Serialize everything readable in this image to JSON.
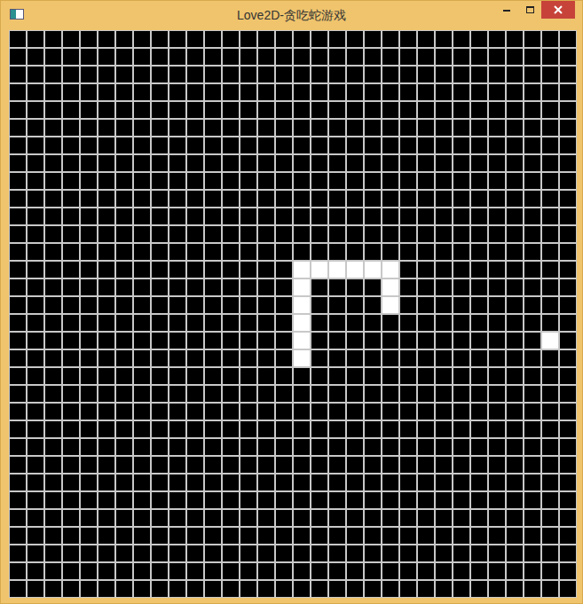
{
  "window": {
    "title": "Love2D-贪吃蛇游戏"
  },
  "snake": [
    {
      "col": 16,
      "row": 18
    },
    {
      "col": 16,
      "row": 17
    },
    {
      "col": 16,
      "row": 16
    },
    {
      "col": 16,
      "row": 15
    },
    {
      "col": 16,
      "row": 14
    },
    {
      "col": 16,
      "row": 13
    },
    {
      "col": 17,
      "row": 13
    },
    {
      "col": 18,
      "row": 13
    },
    {
      "col": 19,
      "row": 13
    },
    {
      "col": 20,
      "row": 13
    },
    {
      "col": 21,
      "row": 13
    },
    {
      "col": 21,
      "row": 14
    },
    {
      "col": 21,
      "row": 15
    }
  ],
  "food": {
    "col": 30,
    "row": 17
  }
}
